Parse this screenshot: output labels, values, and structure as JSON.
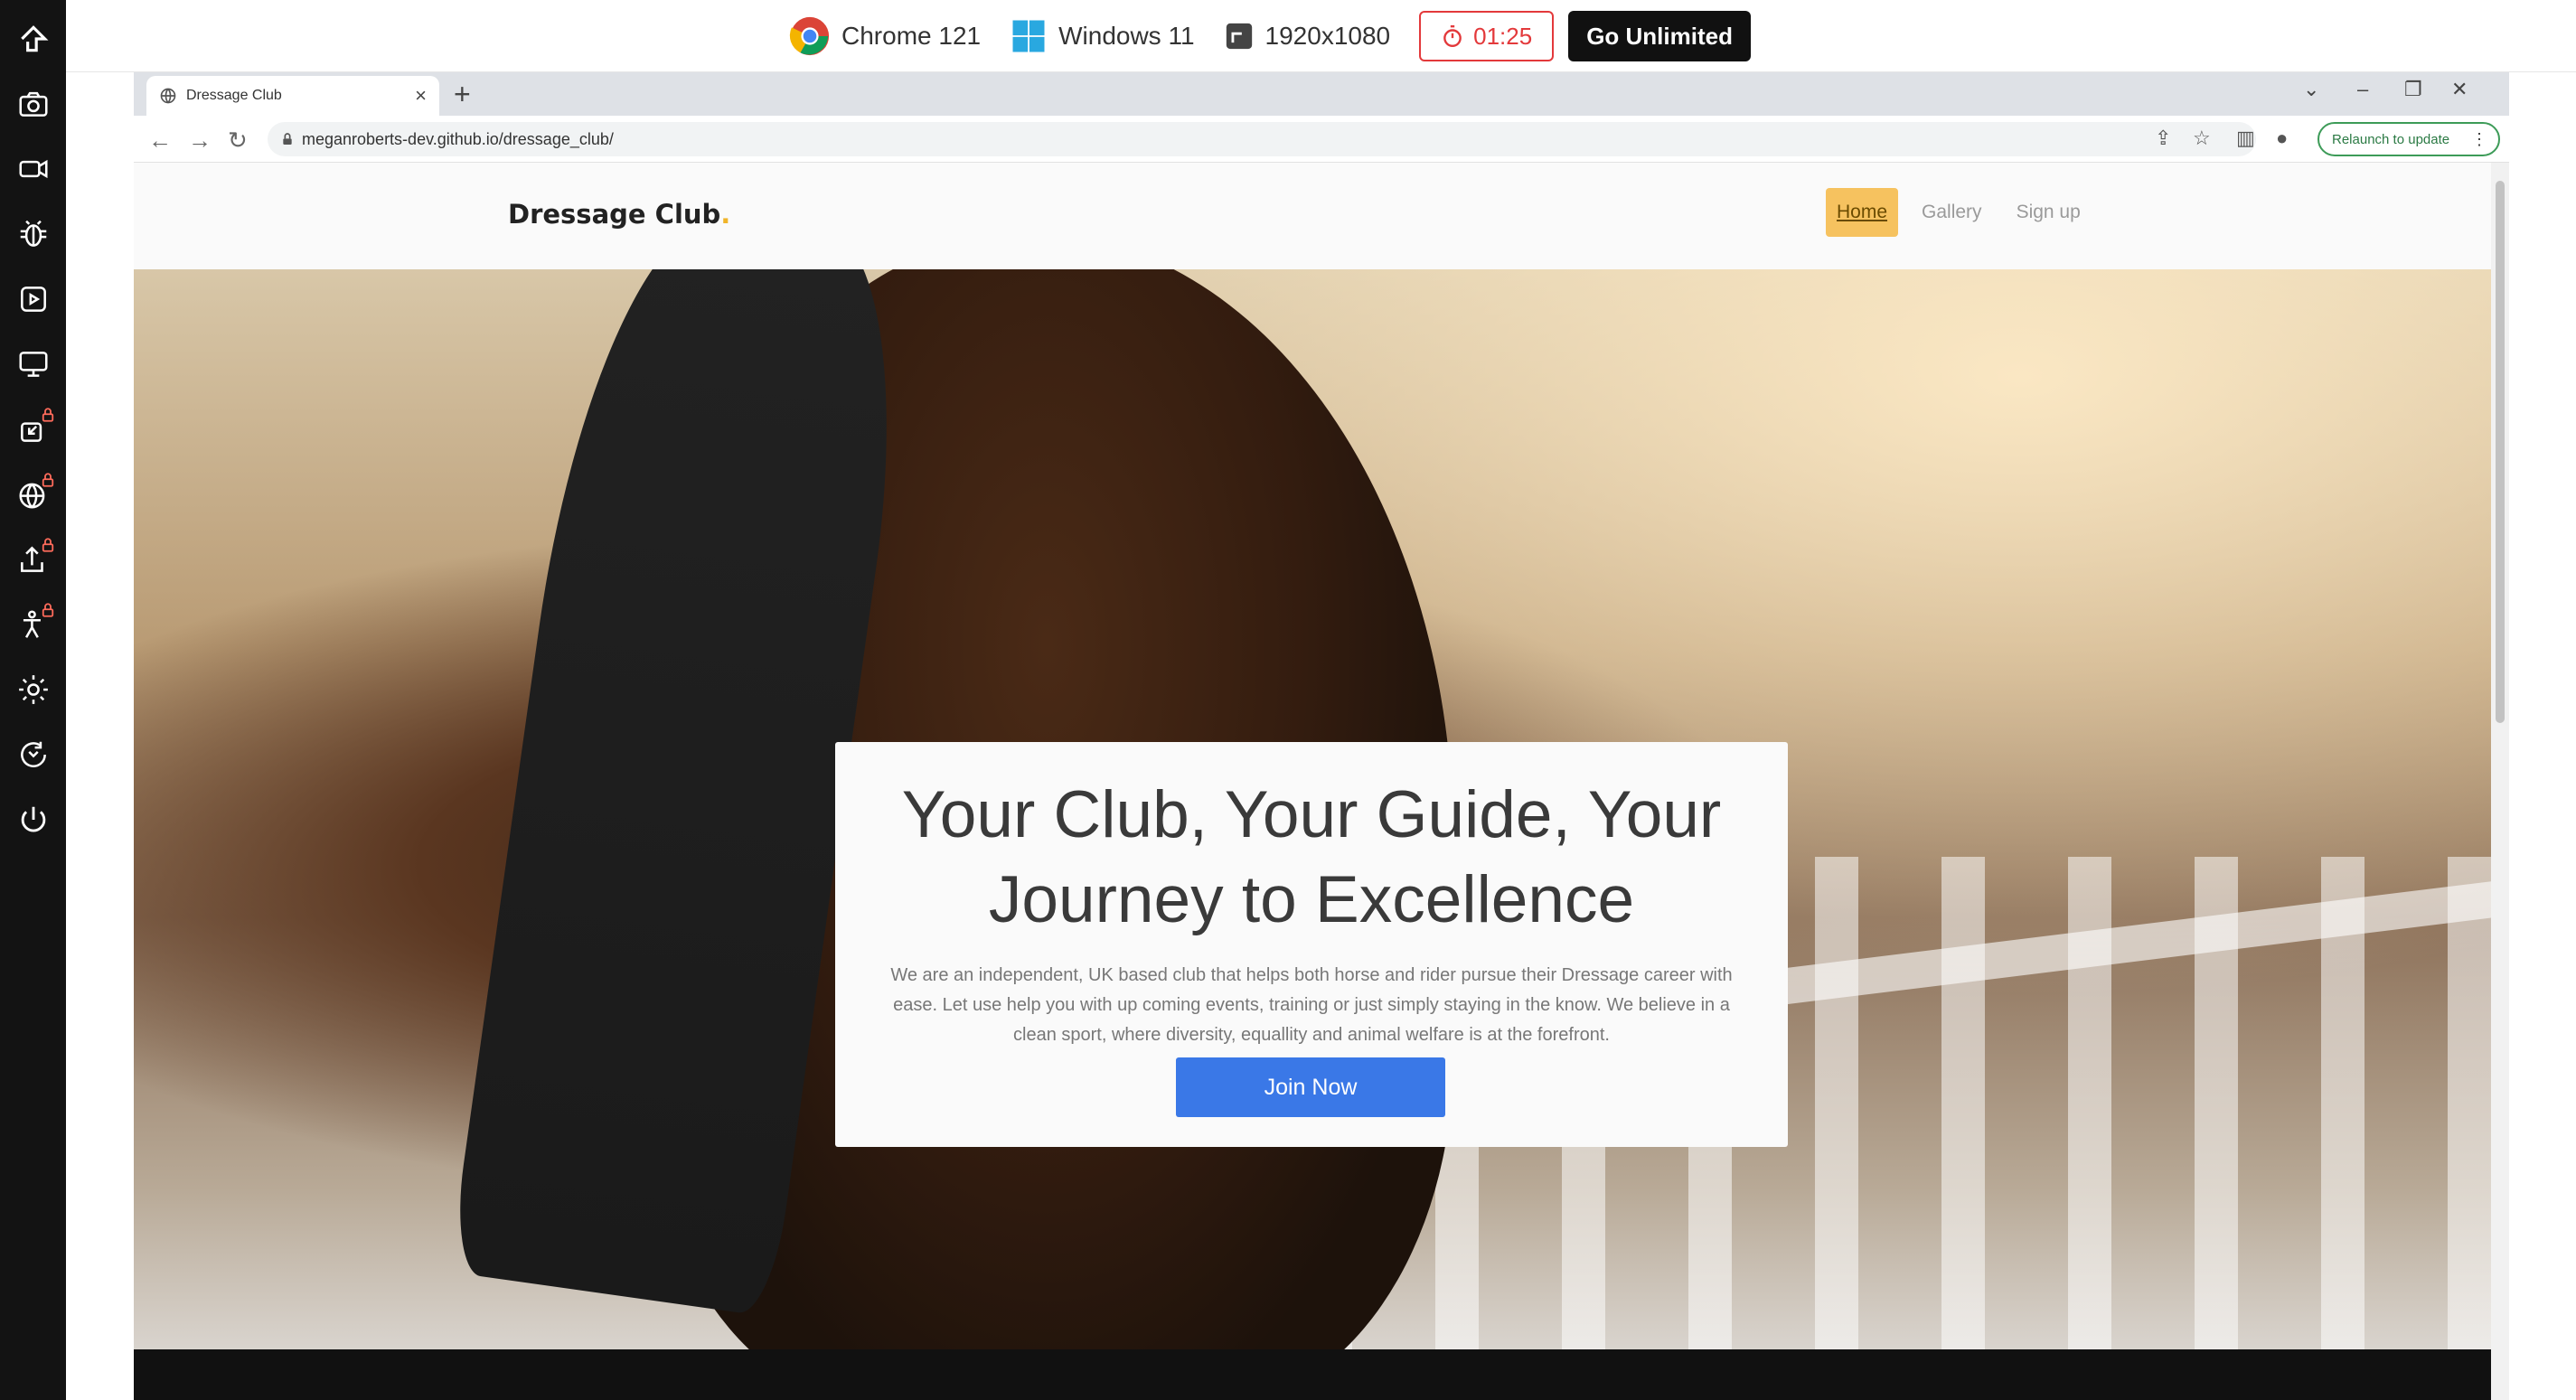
{
  "session": {
    "browser": "Chrome 121",
    "os": "Windows 11",
    "resolution": "1920x1080",
    "timer": "01:25",
    "upgrade_label": "Go Unlimited"
  },
  "browser": {
    "tab_title": "Dressage Club",
    "close_glyph": "×",
    "new_tab_glyph": "+",
    "url": "meganroberts-dev.github.io/dressage_club/",
    "relaunch_label": "Relaunch to update"
  },
  "site": {
    "brand": "Dressage Club",
    "brand_dot": ".",
    "nav": [
      {
        "label": "Home",
        "active": true
      },
      {
        "label": "Gallery",
        "active": false
      },
      {
        "label": "Sign up",
        "active": false
      }
    ]
  },
  "hero": {
    "title": "Your Club, Your Guide, Your Journey to Excellence",
    "text": "We are an independent, UK based club that helps both horse and rider pursue their Dressage career with ease. Let use help you with up coming events, training or just simply staying in the know. We believe in a clean sport, where diversity, equallity and animal welfare is at the forefront.",
    "cta": "Join Now"
  },
  "colors": {
    "accent": "#f6c25f",
    "cta": "#3a78e7",
    "sidebar": "#131313",
    "timer": "#e3393b",
    "relaunch": "#3d9b58"
  }
}
